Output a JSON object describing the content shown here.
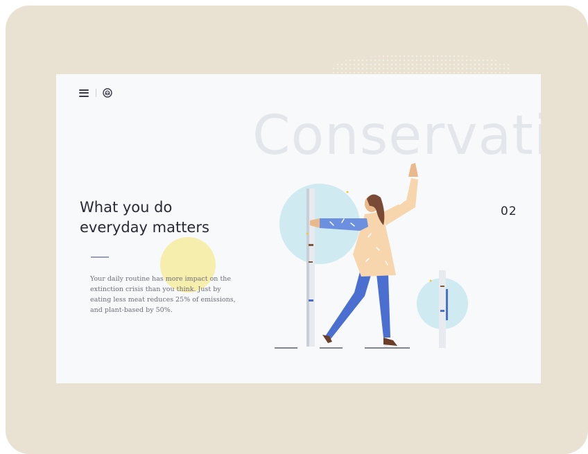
{
  "header": {
    "menu_icon": "hamburger-menu-icon",
    "logo_icon": "globe-logo-icon"
  },
  "hero": {
    "background_word": "Conservatic",
    "headline_line1": "What you do",
    "headline_line2": "everyday matters",
    "body": "Your daily routine has more impact on the extinction crisis than you think. Just by eating less meat reduces 25% of emissions, and plant-based by 50%.",
    "slide_number": "02"
  },
  "colors": {
    "frame": "#e9e2d3",
    "page": "#f7f9fb",
    "text_dark": "#2a2a35",
    "accent_yellow": "#f6ec9e",
    "accent_blue": "#4a6fd1",
    "accent_teal": "#cfeaf0",
    "coat": "#f7d6ad"
  }
}
